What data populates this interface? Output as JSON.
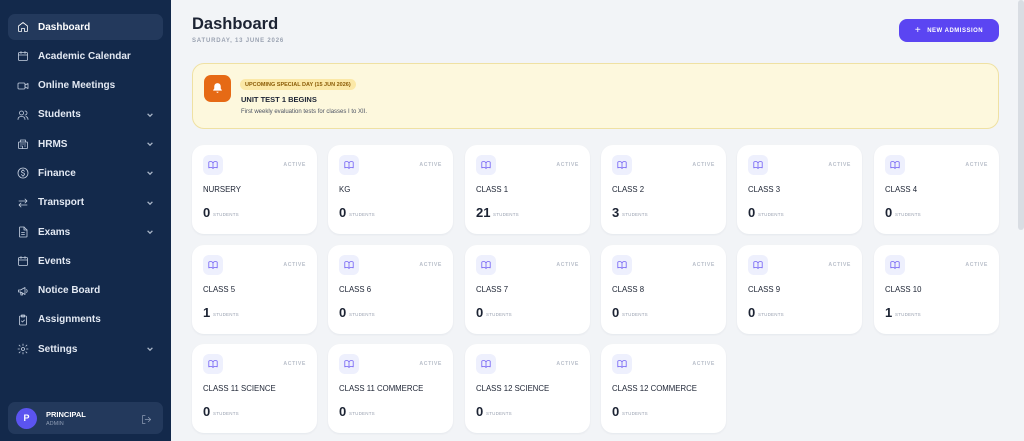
{
  "sidebar": {
    "items": [
      {
        "label": "Dashboard",
        "icon": "home-icon",
        "active": true,
        "expandable": false
      },
      {
        "label": "Academic Calendar",
        "icon": "calendar-icon",
        "active": false,
        "expandable": false
      },
      {
        "label": "Online Meetings",
        "icon": "video-icon",
        "active": false,
        "expandable": false
      },
      {
        "label": "Students",
        "icon": "users-icon",
        "active": false,
        "expandable": true
      },
      {
        "label": "HRMS",
        "icon": "building-icon",
        "active": false,
        "expandable": true
      },
      {
        "label": "Finance",
        "icon": "dollar-icon",
        "active": false,
        "expandable": true
      },
      {
        "label": "Transport",
        "icon": "arrows-icon",
        "active": false,
        "expandable": true
      },
      {
        "label": "Exams",
        "icon": "document-icon",
        "active": false,
        "expandable": true
      },
      {
        "label": "Events",
        "icon": "calendar-icon",
        "active": false,
        "expandable": false
      },
      {
        "label": "Notice Board",
        "icon": "megaphone-icon",
        "active": false,
        "expandable": false
      },
      {
        "label": "Assignments",
        "icon": "clipboard-icon",
        "active": false,
        "expandable": false
      },
      {
        "label": "Settings",
        "icon": "gear-icon",
        "active": false,
        "expandable": true
      }
    ],
    "user": {
      "initial": "P",
      "name": "PRINCIPAL",
      "role": "ADMIN"
    }
  },
  "header": {
    "title": "Dashboard",
    "date": "SATURDAY, 13 JUNE 2026",
    "new_button_label": "NEW ADMISSION"
  },
  "banner": {
    "pill": "UPCOMING SPECIAL DAY (15 JUN 2026)",
    "title": "UNIT TEST 1 BEGINS",
    "description": "First weekly evaluation tests for classes I to XII."
  },
  "classes": [
    {
      "name": "NURSERY",
      "count": "0",
      "status": "ACTIVE",
      "unit": "STUDENTS"
    },
    {
      "name": "KG",
      "count": "0",
      "status": "ACTIVE",
      "unit": "STUDENTS"
    },
    {
      "name": "CLASS 1",
      "count": "21",
      "status": "ACTIVE",
      "unit": "STUDENTS"
    },
    {
      "name": "CLASS 2",
      "count": "3",
      "status": "ACTIVE",
      "unit": "STUDENTS"
    },
    {
      "name": "CLASS 3",
      "count": "0",
      "status": "ACTIVE",
      "unit": "STUDENTS"
    },
    {
      "name": "CLASS 4",
      "count": "0",
      "status": "ACTIVE",
      "unit": "STUDENTS"
    },
    {
      "name": "CLASS 5",
      "count": "1",
      "status": "ACTIVE",
      "unit": "STUDENTS"
    },
    {
      "name": "CLASS 6",
      "count": "0",
      "status": "ACTIVE",
      "unit": "STUDENTS"
    },
    {
      "name": "CLASS 7",
      "count": "0",
      "status": "ACTIVE",
      "unit": "STUDENTS"
    },
    {
      "name": "CLASS 8",
      "count": "0",
      "status": "ACTIVE",
      "unit": "STUDENTS"
    },
    {
      "name": "CLASS 9",
      "count": "0",
      "status": "ACTIVE",
      "unit": "STUDENTS"
    },
    {
      "name": "CLASS 10",
      "count": "1",
      "status": "ACTIVE",
      "unit": "STUDENTS"
    },
    {
      "name": "CLASS 11 SCIENCE",
      "count": "0",
      "status": "ACTIVE",
      "unit": "STUDENTS"
    },
    {
      "name": "CLASS 11 COMMERCE",
      "count": "0",
      "status": "ACTIVE",
      "unit": "STUDENTS"
    },
    {
      "name": "CLASS 12 SCIENCE",
      "count": "0",
      "status": "ACTIVE",
      "unit": "STUDENTS"
    },
    {
      "name": "CLASS 12 COMMERCE",
      "count": "0",
      "status": "ACTIVE",
      "unit": "STUDENTS"
    }
  ],
  "colors": {
    "sidebar_bg": "#13294b",
    "accent": "#5b45f2",
    "banner_bg": "#fdf8dd",
    "bell_bg": "#e66a15"
  }
}
